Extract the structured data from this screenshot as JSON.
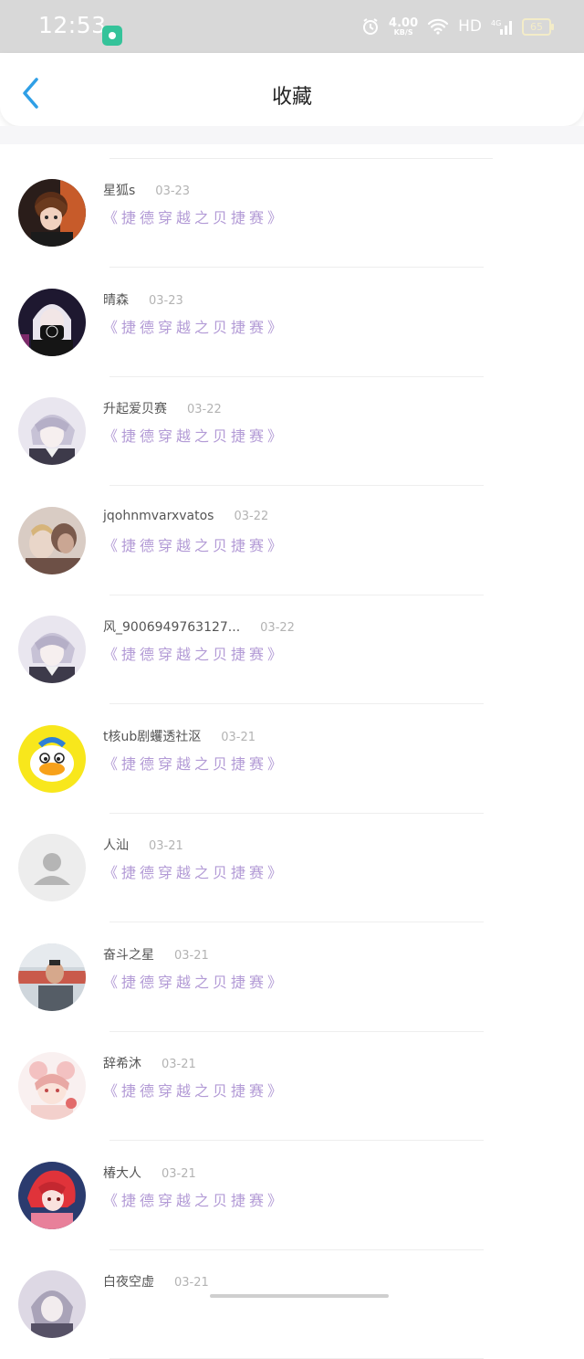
{
  "status_bar": {
    "time": "12:53",
    "net_speed": "4.00",
    "net_unit": "KB/S",
    "hd_label": "HD",
    "network_type": "4G",
    "battery_level": "65"
  },
  "header": {
    "title": "收藏",
    "back_icon": "chevron-left-icon"
  },
  "colors": {
    "accent": "#2f9fe6",
    "title_purple": "#b39bd6",
    "status_bg": "#d8d8d8"
  },
  "favorites": [
    {
      "user": "星狐s",
      "date": "03-23",
      "title": "《捷德穿越之贝捷赛》",
      "avatar": "anime-portrait-brown"
    },
    {
      "user": "晴森",
      "date": "03-23",
      "title": "《捷德穿越之贝捷赛》",
      "avatar": "anime-portrait-dark"
    },
    {
      "user": "升起爱贝赛",
      "date": "03-22",
      "title": "《捷德穿越之贝捷赛》",
      "avatar": "anime-portrait-silver"
    },
    {
      "user": "jqohnmvarxvatos",
      "date": "03-22",
      "title": "《捷德穿越之贝捷赛》",
      "avatar": "photo-portrait-sepia"
    },
    {
      "user": "风_9006949763127...",
      "date": "03-22",
      "title": "《捷德穿越之贝捷赛》",
      "avatar": "anime-portrait-silver"
    },
    {
      "user": "t核ub剧蠼透社沤",
      "date": "03-21",
      "title": "《捷德穿越之贝捷赛》",
      "avatar": "cartoon-duck"
    },
    {
      "user": "人汕",
      "date": "03-21",
      "title": "《捷德穿越之贝捷赛》",
      "avatar": "default-user"
    },
    {
      "user": "奋斗之星",
      "date": "03-21",
      "title": "《捷德穿越之贝捷赛》",
      "avatar": "photo-person"
    },
    {
      "user": "辞希沐",
      "date": "03-21",
      "title": "《捷德穿越之贝捷赛》",
      "avatar": "anime-girl-pink"
    },
    {
      "user": "椿大人",
      "date": "03-21",
      "title": "《捷德穿越之贝捷赛》",
      "avatar": "anime-red-hair"
    },
    {
      "user": "白夜空虚",
      "date": "03-21",
      "title": "",
      "avatar": "anime-portrait-gray"
    }
  ]
}
